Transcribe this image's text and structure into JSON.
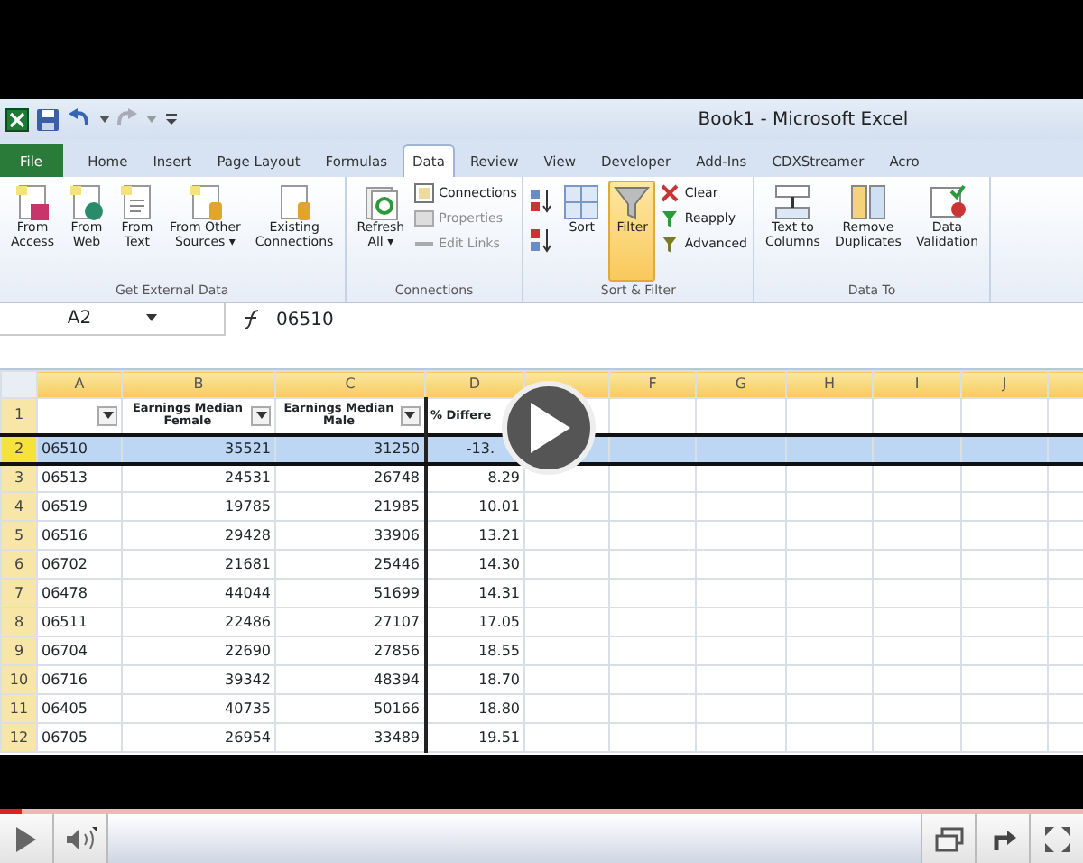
{
  "window": {
    "title": "Book1 - Microsoft Excel"
  },
  "tabs": [
    {
      "label": "File",
      "kind": "file",
      "selected": false
    },
    {
      "label": "Home",
      "kind": "tab",
      "selected": false
    },
    {
      "label": "Insert",
      "kind": "tab",
      "selected": false
    },
    {
      "label": "Page Layout",
      "kind": "tab",
      "selected": false
    },
    {
      "label": "Formulas",
      "kind": "tab",
      "selected": false
    },
    {
      "label": "Data",
      "kind": "tab",
      "selected": true
    },
    {
      "label": "Review",
      "kind": "tab",
      "selected": false
    },
    {
      "label": "View",
      "kind": "tab",
      "selected": false
    },
    {
      "label": "Developer",
      "kind": "tab",
      "selected": false
    },
    {
      "label": "Add-Ins",
      "kind": "tab",
      "selected": false
    },
    {
      "label": "CDXStreamer",
      "kind": "tab",
      "selected": false
    },
    {
      "label": "Acro",
      "kind": "tab",
      "selected": false
    }
  ],
  "ribbon": [
    {
      "label": "Get External Data",
      "items": [
        {
          "kind": "large",
          "label": "From\nAccess"
        },
        {
          "kind": "large",
          "label": "From\nWeb"
        },
        {
          "kind": "large",
          "label": "From\nText"
        },
        {
          "kind": "large",
          "label": "From Other\nSources ▾"
        },
        {
          "kind": "large",
          "label": "Existing\nConnections"
        }
      ]
    },
    {
      "label": "Connections",
      "items": [
        {
          "kind": "large",
          "label": "Refresh\nAll ▾",
          "disabled": false
        },
        {
          "kind": "small",
          "label": "Connections",
          "disabled": false
        },
        {
          "kind": "small",
          "label": "Properties",
          "disabled": true
        },
        {
          "kind": "small",
          "label": "Edit Links",
          "disabled": true
        }
      ]
    },
    {
      "label": "Sort & Filter",
      "items": [
        {
          "kind": "sortpair"
        },
        {
          "kind": "large",
          "label": "Sort",
          "on": false
        },
        {
          "kind": "large",
          "label": "Filter",
          "on": true
        },
        {
          "kind": "small",
          "label": "Clear"
        },
        {
          "kind": "small",
          "label": "Reapply"
        },
        {
          "kind": "small",
          "label": "Advanced"
        }
      ]
    },
    {
      "label": "Data To",
      "items": [
        {
          "kind": "large",
          "label": "Text to\nColumns"
        },
        {
          "kind": "large",
          "label": "Remove\nDuplicates"
        },
        {
          "kind": "large",
          "label": "Data\nValidation"
        }
      ]
    }
  ],
  "formula_bar": {
    "name_box": "A2",
    "formula": "06510"
  },
  "columns": [
    "A",
    "B",
    "C",
    "D",
    "",
    "F",
    "G",
    "H",
    "I",
    "J"
  ],
  "rows": [
    {
      "header": "1",
      "selected": false,
      "cells": [
        "",
        "Earnings Median\nFemale",
        "Earnings Median\nMale",
        "% Differe"
      ]
    },
    {
      "header": "2",
      "selected": true,
      "cells": [
        "06510",
        "35521",
        "31250",
        "-13."
      ]
    },
    {
      "header": "3",
      "selected": false,
      "cells": [
        "06513",
        "24531",
        "26748",
        "8.29"
      ]
    },
    {
      "header": "4",
      "selected": false,
      "cells": [
        "06519",
        "19785",
        "21985",
        "10.01"
      ]
    },
    {
      "header": "5",
      "selected": false,
      "cells": [
        "06516",
        "29428",
        "33906",
        "13.21"
      ]
    },
    {
      "header": "6",
      "selected": false,
      "cells": [
        "06702",
        "21681",
        "25446",
        "14.30"
      ]
    },
    {
      "header": "7",
      "selected": false,
      "cells": [
        "06478",
        "44044",
        "51699",
        "14.31"
      ]
    },
    {
      "header": "8",
      "selected": false,
      "cells": [
        "06511",
        "22486",
        "27107",
        "17.05"
      ]
    },
    {
      "header": "9",
      "selected": false,
      "cells": [
        "06704",
        "22690",
        "27856",
        "18.55"
      ]
    },
    {
      "header": "10",
      "selected": false,
      "cells": [
        "06716",
        "39342",
        "48394",
        "18.70"
      ]
    },
    {
      "header": "11",
      "selected": false,
      "cells": [
        "06405",
        "40735",
        "50166",
        "18.80"
      ]
    },
    {
      "header": "12",
      "selected": false,
      "cells": [
        "06705",
        "26954",
        "33489",
        "19.51"
      ]
    }
  ],
  "player": {
    "level": 0.02
  }
}
